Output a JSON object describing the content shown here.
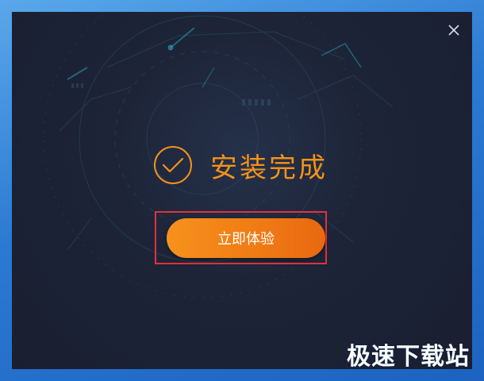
{
  "dialog": {
    "success_text": "安装完成",
    "start_button_label": "立即体验",
    "close_icon": "close-icon",
    "check_icon": "check-circle-icon"
  },
  "watermark": {
    "text": "极速下载站"
  },
  "colors": {
    "accent": "#f39219",
    "button_start": "#f7911c",
    "button_end": "#e9680f",
    "window_bg": "#1d2438",
    "highlight_border": "#e0323c",
    "desktop_bg": "#2f7bd4"
  }
}
